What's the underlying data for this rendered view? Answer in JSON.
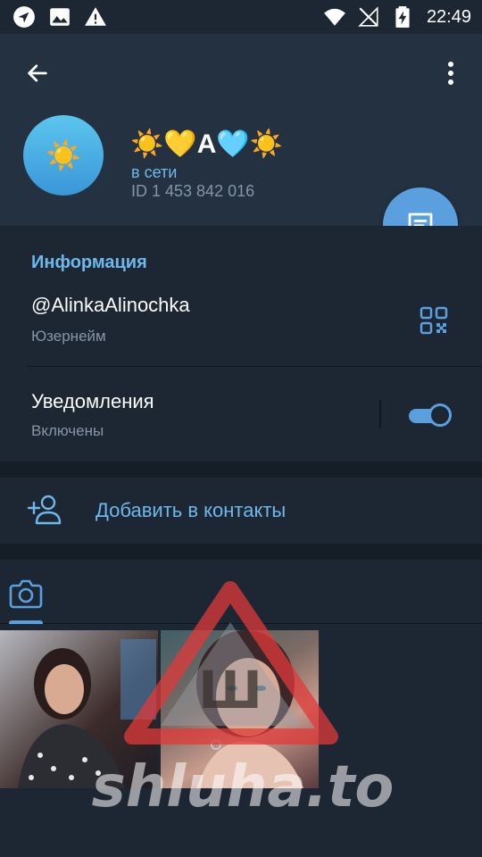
{
  "status_bar": {
    "time": "22:49",
    "left_icons": [
      "navigation-icon",
      "image-icon",
      "warning-icon"
    ],
    "right_icons": [
      "wifi-icon",
      "no-signal-icon",
      "battery-icon"
    ]
  },
  "profile": {
    "name": "☀️💛A🩵☀️",
    "status": "в сети",
    "id_text": "ID 1 453 842 016",
    "avatar_emoji": "☀️"
  },
  "info": {
    "section_title": "Информация",
    "username": "@AlinkaAlinochka",
    "username_label": "Юзернейм",
    "notifications_title": "Уведомления",
    "notifications_status": "Включены",
    "notifications_on": true
  },
  "actions": {
    "add_contact_label": "Добавить в контакты"
  },
  "media": {
    "active_tab": "photos",
    "thumbnails": 2
  },
  "watermark": {
    "text": "shluha.to",
    "sign_letter": "Ш"
  },
  "colors": {
    "background": "#1d2733",
    "header": "#243140",
    "accent": "#5aa0df",
    "accent_text": "#6eb8ec",
    "secondary_text": "#8595a6"
  }
}
